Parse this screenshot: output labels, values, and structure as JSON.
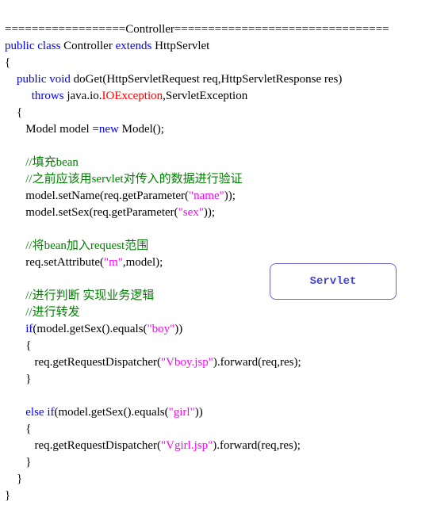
{
  "header": "==================Controller================================",
  "code": {
    "l1_kw1": "public",
    "l1_kw2": "class",
    "l1_cls": " Controller ",
    "l1_kw3": "extends",
    "l1_rest": " HttpServlet",
    "l2": "{",
    "l3_pad": "    ",
    "l3_kw1": "public",
    "l3_sp": " ",
    "l3_kw2": "void",
    "l3_rest": " doGet(HttpServletRequest req,HttpServletResponse res)",
    "l4_pad": "         ",
    "l4_kw": "throws",
    "l4_mid": " java.io.",
    "l4_err": "IOException",
    "l4_rest": ",ServletException",
    "l5": "    {",
    "l6_pad": "       ",
    "l6_a": "Model model =",
    "l6_kw": "new",
    "l6_b": " Model();",
    "blank": "",
    "l7_pad": "       ",
    "l7_com": "//填充bean",
    "l8_pad": "       ",
    "l8_com": "//之前应该用servlet对传入的数据进行验证",
    "l9_pad": "       ",
    "l9_a": "model.setName(req.getParameter(",
    "l9_str": "\"name\"",
    "l9_b": "));",
    "l10_pad": "       ",
    "l10_a": "model.setSex(req.getParameter(",
    "l10_str": "\"sex\"",
    "l10_b": "));",
    "l11_pad": "       ",
    "l11_com": "//将bean加入request范围",
    "l12_pad": "       ",
    "l12_a": "req.setAttribute(",
    "l12_str": "\"m\"",
    "l12_b": ",model);",
    "l13_pad": "       ",
    "l13_com": "//进行判断 实现业务逻辑",
    "l14_pad": "       ",
    "l14_com": "//进行转发",
    "l15_pad": "       ",
    "l15_kw": "if",
    "l15_a": "(model.getSex().equals(",
    "l15_str": "\"boy\"",
    "l15_b": "))",
    "l16": "       {",
    "l17_pad": "          ",
    "l17_a": "req.getRequestDispatcher(",
    "l17_str": "\"Vboy.jsp\"",
    "l17_b": ").forward(req,res);",
    "l18": "       }",
    "l19_pad": "       ",
    "l19_kw1": "else",
    "l19_sp": " ",
    "l19_kw2": "if",
    "l19_a": "(model.getSex().equals(",
    "l19_str": "\"girl\"",
    "l19_b": "))",
    "l20": "       {",
    "l21_pad": "          ",
    "l21_a": "req.getRequestDispatcher(",
    "l21_str": "\"Vgirl.jsp\"",
    "l21_b": ").forward(req,res);",
    "l22": "       }",
    "l23": "    }",
    "l24": "}"
  },
  "callout": "Servlet"
}
